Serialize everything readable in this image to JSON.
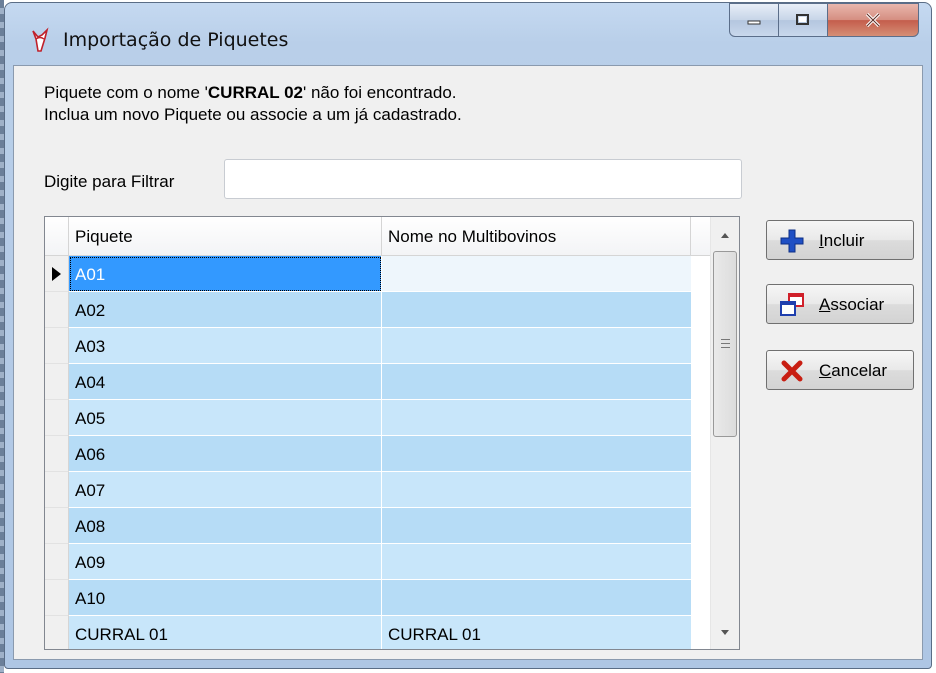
{
  "window": {
    "title": "Importação de Piquetes",
    "controls": [
      "minimize-icon",
      "maximize-icon",
      "close-icon"
    ]
  },
  "message": {
    "line1_prefix": "Piquete com o nome '",
    "line1_name": "CURRAL 02",
    "line1_suffix": "' não foi encontrado.",
    "line2": "Inclua um novo Piquete ou associe a um já cadastrado."
  },
  "filter": {
    "label": "Digite para Filtrar",
    "value": ""
  },
  "grid": {
    "columns": [
      "Piquete",
      "Nome no Multibovinos"
    ],
    "rows": [
      {
        "piquete": "A01",
        "nome": ""
      },
      {
        "piquete": "A02",
        "nome": ""
      },
      {
        "piquete": "A03",
        "nome": ""
      },
      {
        "piquete": "A04",
        "nome": ""
      },
      {
        "piquete": "A05",
        "nome": ""
      },
      {
        "piquete": "A06",
        "nome": ""
      },
      {
        "piquete": "A07",
        "nome": ""
      },
      {
        "piquete": "A08",
        "nome": ""
      },
      {
        "piquete": "A09",
        "nome": ""
      },
      {
        "piquete": "A10",
        "nome": ""
      },
      {
        "piquete": "CURRAL 01",
        "nome": "CURRAL 01"
      }
    ]
  },
  "buttons": {
    "incluir": {
      "first": "I",
      "rest": "ncluir",
      "icon": "plus-icon"
    },
    "associar": {
      "first": "A",
      "rest": "ssociar",
      "icon": "associate-windows-icon"
    },
    "cancelar": {
      "first": "C",
      "rest": "ancelar",
      "icon": "red-x-icon"
    }
  },
  "colors": {
    "selection": "#3399ff",
    "row_odd": "#b6dcf6",
    "row_even": "#c8e6fa"
  }
}
